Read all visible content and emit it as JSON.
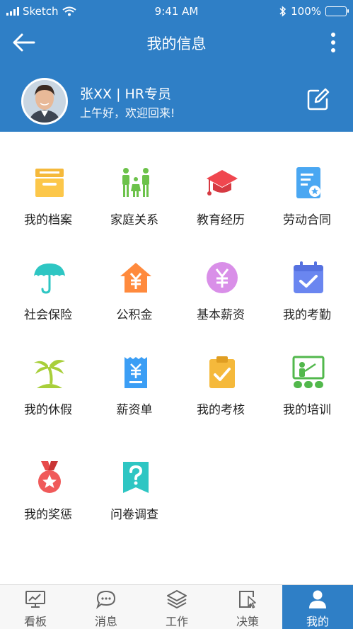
{
  "status_bar": {
    "carrier": "Sketch",
    "time": "9:41 AM",
    "battery": "100%"
  },
  "header": {
    "title": "我的信息"
  },
  "profile": {
    "name": "张XX | HR专员",
    "greeting": "上午好，欢迎回来!"
  },
  "colors": {
    "primary": "#2f7fc6"
  },
  "grid": [
    {
      "label": "我的档案",
      "icon": "archive-box-icon"
    },
    {
      "label": "家庭关系",
      "icon": "family-icon"
    },
    {
      "label": "教育经历",
      "icon": "graduation-cap-icon"
    },
    {
      "label": "劳动合同",
      "icon": "contract-icon"
    },
    {
      "label": "社会保险",
      "icon": "umbrella-icon"
    },
    {
      "label": "公积金",
      "icon": "housing-fund-icon"
    },
    {
      "label": "基本薪资",
      "icon": "salary-yen-icon"
    },
    {
      "label": "我的考勤",
      "icon": "attendance-calendar-icon"
    },
    {
      "label": "我的休假",
      "icon": "palm-tree-icon"
    },
    {
      "label": "薪资单",
      "icon": "payslip-icon"
    },
    {
      "label": "我的考核",
      "icon": "assessment-clipboard-icon"
    },
    {
      "label": "我的培训",
      "icon": "training-board-icon"
    },
    {
      "label": "我的奖惩",
      "icon": "medal-icon"
    },
    {
      "label": "问卷调查",
      "icon": "survey-question-icon"
    }
  ],
  "tabs": [
    {
      "label": "看板",
      "icon": "dashboard-icon",
      "active": false
    },
    {
      "label": "消息",
      "icon": "message-icon",
      "active": false
    },
    {
      "label": "工作",
      "icon": "layers-icon",
      "active": false
    },
    {
      "label": "决策",
      "icon": "decision-icon",
      "active": false
    },
    {
      "label": "我的",
      "icon": "user-icon",
      "active": true
    }
  ]
}
